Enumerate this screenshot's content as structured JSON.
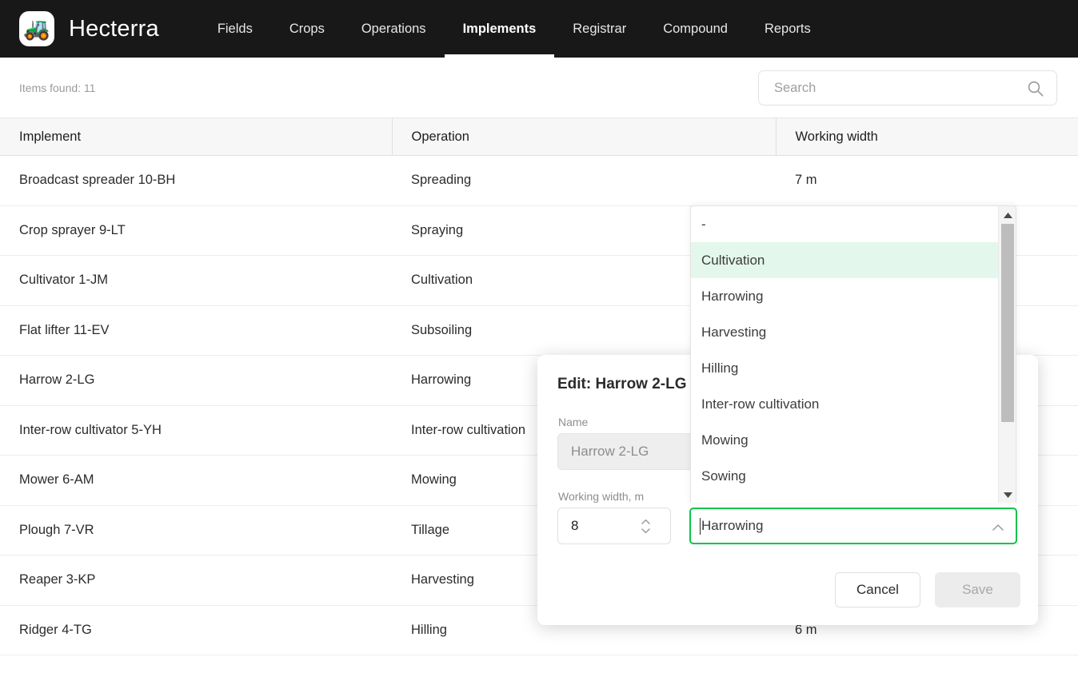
{
  "header": {
    "brand_logo_glyph": "🚜",
    "brand_title": "Hecterra",
    "nav": [
      {
        "label": "Fields",
        "active": false
      },
      {
        "label": "Crops",
        "active": false
      },
      {
        "label": "Operations",
        "active": false
      },
      {
        "label": "Implements",
        "active": true
      },
      {
        "label": "Registrar",
        "active": false
      },
      {
        "label": "Compound",
        "active": false
      },
      {
        "label": "Reports",
        "active": false
      }
    ]
  },
  "toolbar": {
    "items_found": "Items found: 11",
    "search_placeholder": "Search",
    "search_value": ""
  },
  "table": {
    "columns": [
      "Implement",
      "Operation",
      "Working width"
    ],
    "rows": [
      {
        "implement": "Broadcast spreader 10-BH",
        "operation": "Spreading",
        "width": "7 m"
      },
      {
        "implement": "Crop sprayer 9-LT",
        "operation": "Spraying",
        "width": ""
      },
      {
        "implement": "Cultivator 1-JM",
        "operation": "Cultivation",
        "width": ""
      },
      {
        "implement": "Flat lifter 11-EV",
        "operation": "Subsoiling",
        "width": ""
      },
      {
        "implement": "Harrow 2-LG",
        "operation": "Harrowing",
        "width": ""
      },
      {
        "implement": "Inter-row cultivator 5-YH",
        "operation": "Inter-row cultivation",
        "width": ""
      },
      {
        "implement": "Mower 6-AM",
        "operation": "Mowing",
        "width": ""
      },
      {
        "implement": "Plough 7-VR",
        "operation": "Tillage",
        "width": ""
      },
      {
        "implement": "Reaper 3-KP",
        "operation": "Harvesting",
        "width": ""
      },
      {
        "implement": "Ridger 4-TG",
        "operation": "Hilling",
        "width": "6 m"
      }
    ]
  },
  "modal": {
    "title": "Edit: Harrow 2-LG",
    "name_label": "Name",
    "name_value": "Harrow 2-LG",
    "width_label": "Working width, m",
    "width_value": "8",
    "cancel_label": "Cancel",
    "save_label": "Save"
  },
  "operation_combobox": {
    "value": "Harrowing",
    "expanded": true,
    "options": [
      "-",
      "Cultivation",
      "Harrowing",
      "Harvesting",
      "Hilling",
      "Inter-row cultivation",
      "Mowing",
      "Sowing"
    ],
    "highlighted": "Cultivation"
  },
  "colors": {
    "header_bg": "#181818",
    "accent_green": "#0ac44a",
    "option_highlight": "#e4f7ec",
    "disabled_bg": "#eeeeee"
  }
}
